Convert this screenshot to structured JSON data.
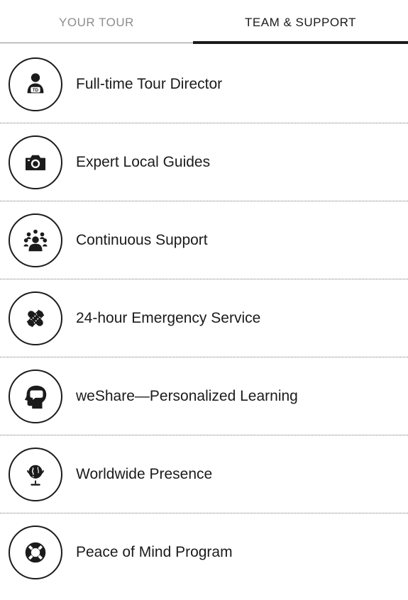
{
  "tabs": {
    "your_tour": "YOUR TOUR",
    "team_support": "TEAM & SUPPORT",
    "active": "team_support"
  },
  "items": [
    {
      "label": "Full-time Tour Director",
      "icon": "tour-director-icon"
    },
    {
      "label": "Expert Local Guides",
      "icon": "camera-icon"
    },
    {
      "label": "Continuous Support",
      "icon": "group-support-icon"
    },
    {
      "label": "24-hour Emergency Service",
      "icon": "bandages-icon"
    },
    {
      "label": "weShare—Personalized Learning",
      "icon": "head-speech-icon"
    },
    {
      "label": "Worldwide Presence",
      "icon": "globe-icon"
    },
    {
      "label": "Peace of Mind Program",
      "icon": "life-ring-icon"
    }
  ],
  "icon_badge_text": "TD",
  "colors": {
    "icon": "#1b1b1b",
    "text": "#1b1b1b",
    "inactive_tab": "#8d8d8d",
    "divider": "#777777"
  }
}
